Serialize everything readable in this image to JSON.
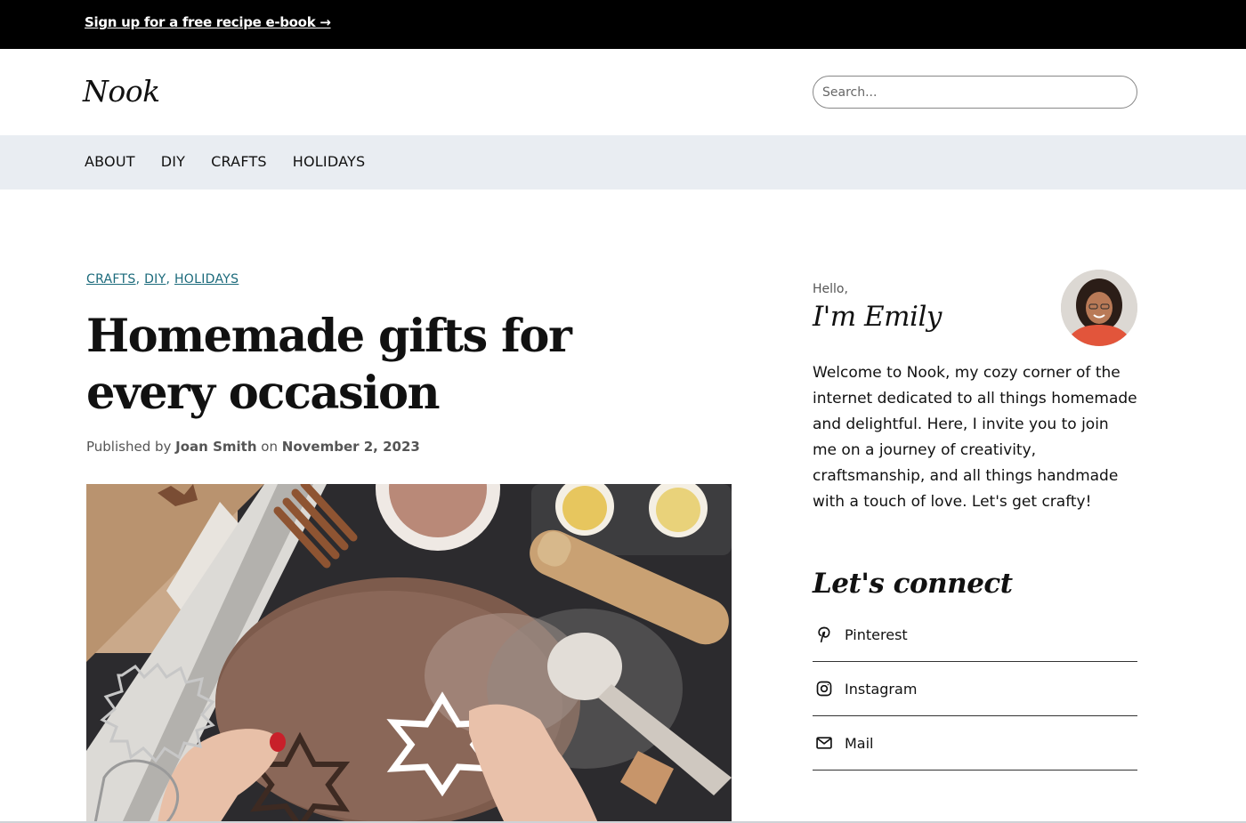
{
  "promo": {
    "text": "Sign up for a free recipe e-book →"
  },
  "header": {
    "logo": "Nook"
  },
  "search": {
    "placeholder": "Search..."
  },
  "nav": {
    "items": [
      "ABOUT",
      "DIY",
      "CRAFTS",
      "HOLIDAYS"
    ]
  },
  "post": {
    "categories": [
      "CRAFTS",
      "DIY",
      "HOLIDAYS"
    ],
    "title": "Homemade gifts for every occasion",
    "byline_prefix": "Published by",
    "author": "Joan Smith",
    "byline_on": "on",
    "date": "November 2, 2023"
  },
  "sidebar": {
    "greeting": "Hello,",
    "name": "I'm Emily",
    "intro": "Welcome to Nook, my cozy corner of the internet dedicated to all things homemade and delightful. Here, I invite you to join me on a journey of creativity, craftsmanship, and all things handmade with a touch of love. Let's get crafty!",
    "connect_title": "Let's connect",
    "social": [
      {
        "label": "Pinterest",
        "icon": "pinterest-icon"
      },
      {
        "label": "Instagram",
        "icon": "instagram-icon"
      },
      {
        "label": "Mail",
        "icon": "mail-icon"
      }
    ]
  },
  "colors": {
    "topbar": "#000000",
    "nav_bg": "#e9edf2",
    "category_link": "#1b6a7b"
  }
}
